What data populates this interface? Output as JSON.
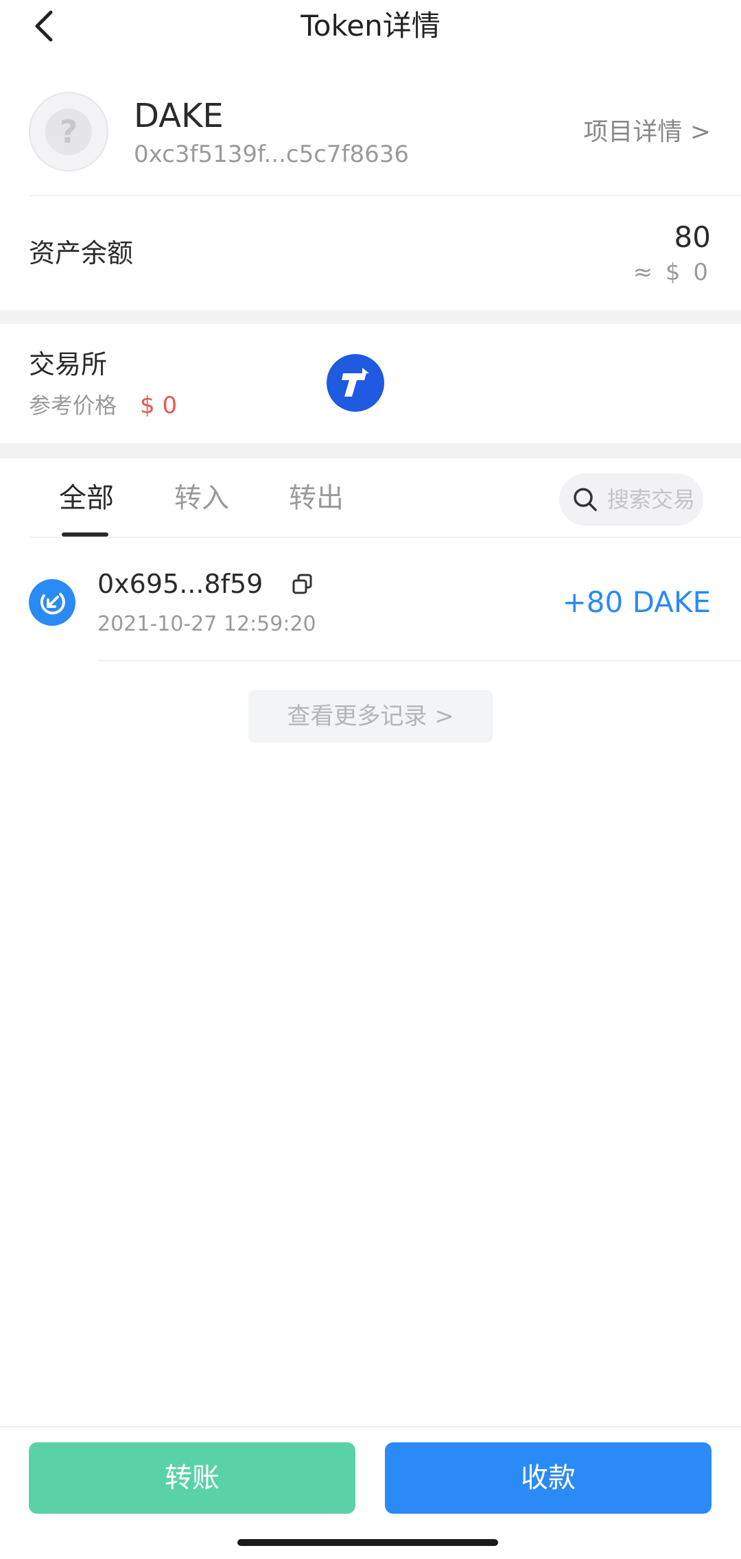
{
  "header": {
    "title": "Token详情"
  },
  "token": {
    "symbol": "DAKE",
    "address": "0xc3f5139f...c5c7f8636",
    "logo_glyph": "?",
    "project_link": "项目详情 >"
  },
  "balance": {
    "label": "资产余额",
    "amount": "80",
    "fiat": "≈ $ 0"
  },
  "exchange": {
    "label": "交易所",
    "ref_price_label": "参考价格",
    "ref_price_value": "$ 0"
  },
  "tabs": [
    {
      "label": "全部",
      "active": true
    },
    {
      "label": "转入",
      "active": false
    },
    {
      "label": "转出",
      "active": false
    }
  ],
  "search": {
    "placeholder": "搜索交易"
  },
  "transactions": [
    {
      "hash": "0x695...8f59",
      "time": "2021-10-27 12:59:20",
      "amount": "+80 DAKE",
      "direction": "in"
    }
  ],
  "more_records": "查看更多记录 >",
  "actions": {
    "transfer": "转账",
    "receive": "收款"
  },
  "colors": {
    "accent_blue": "#2a8af6",
    "transfer_green": "#5ad2a8",
    "price_red": "#e5584f",
    "exchange_blue": "#1f5ae0"
  }
}
